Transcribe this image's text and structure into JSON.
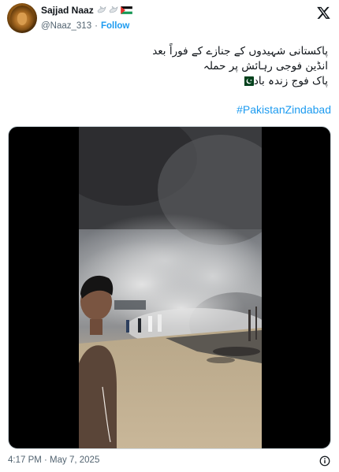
{
  "author": {
    "display_name": "Sajjad Naaz",
    "handle": "@Naaz_313",
    "separator": "·",
    "follow_label": "Follow",
    "name_badges": [
      "dove-icon",
      "dove-icon",
      "palestine-flag-icon"
    ]
  },
  "tweet": {
    "lines": [
      "پاکستانی شہیدوں کے جنازے کے فوراً بعد",
      "انڈین فوجی رہائش پر حملہ",
      "پاک فوج زندہ باد"
    ],
    "line3_emoji": "pakistan-flag-icon",
    "hashtag": "#PakistanZindabad"
  },
  "media": {
    "type": "video",
    "description_icon": "video-frame"
  },
  "footer": {
    "timestamp": "4:17 PM · May 7, 2025"
  },
  "colors": {
    "link_blue": "#1d9bf0",
    "secondary_text": "#536471",
    "primary_text": "#0f1419"
  }
}
